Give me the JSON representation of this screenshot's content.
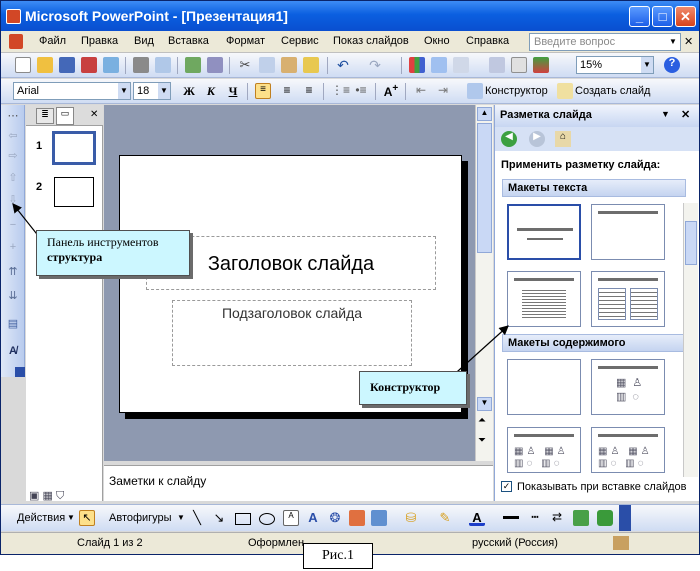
{
  "title": "Microsoft PowerPoint - [Презентация1]",
  "menu": [
    "Файл",
    "Правка",
    "Вид",
    "Вставка",
    "Формат",
    "Сервис",
    "Показ слайдов",
    "Окно",
    "Справка"
  ],
  "search_placeholder": "Введите вопрос",
  "zoom": "15%",
  "font_name": "Arial",
  "font_size": "18",
  "format_buttons": {
    "bold": "Ж",
    "italic": "К",
    "underline": "Ч"
  },
  "designer_label": "Конструктор",
  "new_slide_label": "Создать слайд",
  "slides": [
    "1",
    "2"
  ],
  "slide": {
    "title": "Заголовок слайда",
    "subtitle": "Подзаголовок слайда"
  },
  "notes": "Заметки к слайду",
  "taskpane": {
    "title": "Разметка слайда",
    "apply": "Применить разметку слайда:",
    "text_layouts": "Макеты текста",
    "content_layouts": "Макеты содержимого",
    "show_on_insert": "Показывать при вставке слайдов"
  },
  "drawing": {
    "actions": "Действия",
    "autoshapes": "Автофигуры"
  },
  "status": {
    "slide": "Слайд 1 из 2",
    "design": "Оформлен",
    "language": "русский (Россия)"
  },
  "callouts": {
    "outline_line1": "Панель инструментов",
    "outline_line2": "структура",
    "designer": "Конструктор"
  },
  "figure_caption": "Рис.1",
  "colors": {
    "title_bar": "#0b5fe0",
    "toolbar": "#cfdcf3",
    "callout": "#ccf7ff",
    "edit_bg": "#8e99b0"
  }
}
